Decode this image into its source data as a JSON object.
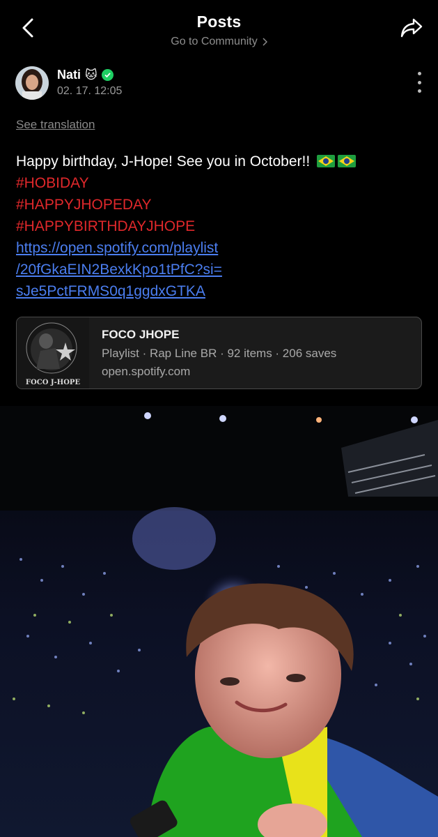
{
  "header": {
    "title": "Posts",
    "subtitle": "Go to Community"
  },
  "author": {
    "name": "Nati",
    "name_emoji": "🐱",
    "timestamp": "02. 17. 12:05"
  },
  "post": {
    "see_translation": "See translation",
    "text": "Happy birthday, J-Hope! See you in October!!",
    "hashtags": [
      "#HOBIDAY",
      "#HAPPYJHOPEDAY",
      "#HAPPYBIRTHDAYJHOPE"
    ],
    "link_lines": [
      "https://open.spotify.com/playlist",
      "/20fGkaEIN2BexkKpo1tPfC?si=",
      "sJe5PctFRMS0q1ggdxGTKA"
    ]
  },
  "link_card": {
    "title": "FOCO JHOPE",
    "subtitle": "Playlist · Rap Line BR · 92 items · 206 saves",
    "url": "open.spotify.com",
    "thumb_caption": "FOCO J-HOPE"
  },
  "colors": {
    "hashtag": "#e0282b",
    "link": "#4b7ef0",
    "verified": "#1ecf63"
  }
}
